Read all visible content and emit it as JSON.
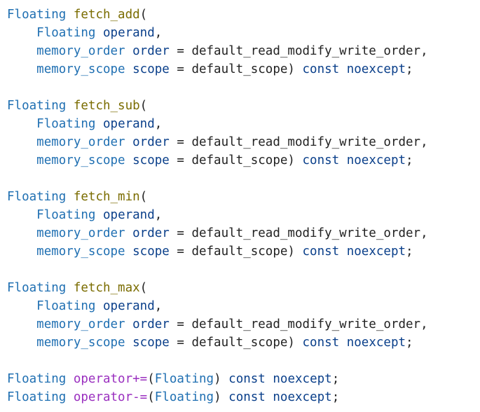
{
  "functions": [
    {
      "ret": "Floating",
      "name": "fetch_add",
      "params": [
        {
          "type": "Floating",
          "name": "operand",
          "default": null
        },
        {
          "type": "memory_order",
          "name": "order",
          "default": "default_read_modify_write_order"
        },
        {
          "type": "memory_scope",
          "name": "scope",
          "default": "default_scope"
        }
      ],
      "qualifiers": [
        "const",
        "noexcept"
      ]
    },
    {
      "ret": "Floating",
      "name": "fetch_sub",
      "params": [
        {
          "type": "Floating",
          "name": "operand",
          "default": null
        },
        {
          "type": "memory_order",
          "name": "order",
          "default": "default_read_modify_write_order"
        },
        {
          "type": "memory_scope",
          "name": "scope",
          "default": "default_scope"
        }
      ],
      "qualifiers": [
        "const",
        "noexcept"
      ]
    },
    {
      "ret": "Floating",
      "name": "fetch_min",
      "params": [
        {
          "type": "Floating",
          "name": "operand",
          "default": null
        },
        {
          "type": "memory_order",
          "name": "order",
          "default": "default_read_modify_write_order"
        },
        {
          "type": "memory_scope",
          "name": "scope",
          "default": "default_scope"
        }
      ],
      "qualifiers": [
        "const",
        "noexcept"
      ]
    },
    {
      "ret": "Floating",
      "name": "fetch_max",
      "params": [
        {
          "type": "Floating",
          "name": "operand",
          "default": null
        },
        {
          "type": "memory_order",
          "name": "order",
          "default": "default_read_modify_write_order"
        },
        {
          "type": "memory_scope",
          "name": "scope",
          "default": "default_scope"
        }
      ],
      "qualifiers": [
        "const",
        "noexcept"
      ]
    }
  ],
  "operators": [
    {
      "ret": "Floating",
      "keyword": "operator",
      "sym": "+=",
      "param_type": "Floating",
      "qualifiers": [
        "const",
        "noexcept"
      ]
    },
    {
      "ret": "Floating",
      "keyword": "operator",
      "sym": "-=",
      "param_type": "Floating",
      "qualifiers": [
        "const",
        "noexcept"
      ]
    }
  ],
  "punct": {
    "open": "(",
    "close": ")",
    "comma": ",",
    "eq": " = ",
    "semi": ";",
    "sp": " ",
    "indent": "    "
  }
}
